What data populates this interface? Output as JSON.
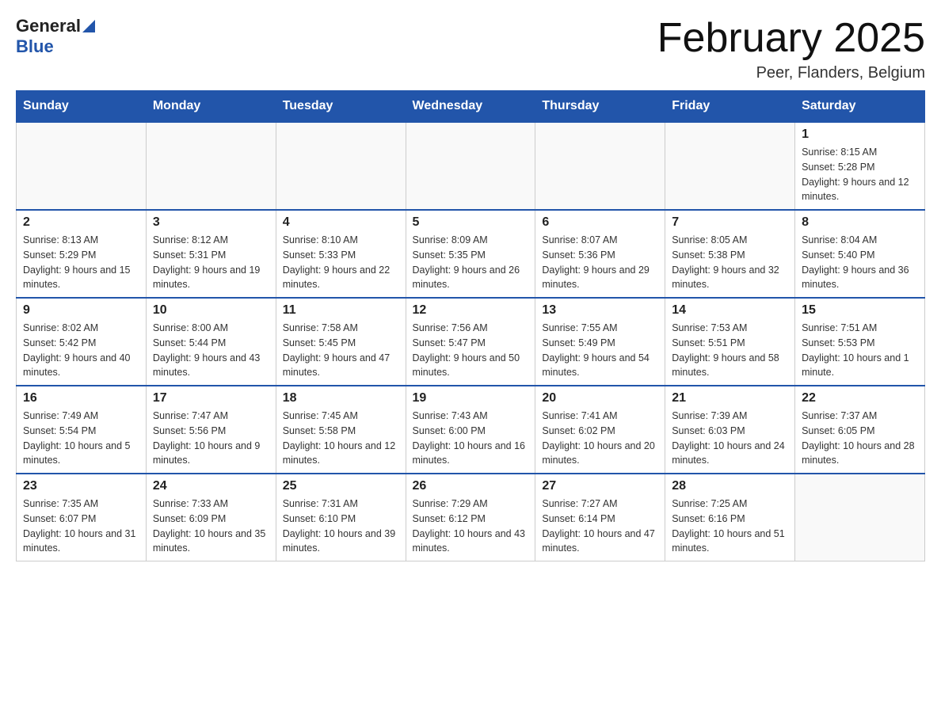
{
  "header": {
    "logo_general": "General",
    "logo_blue": "Blue",
    "month_title": "February 2025",
    "location": "Peer, Flanders, Belgium"
  },
  "days_of_week": [
    "Sunday",
    "Monday",
    "Tuesday",
    "Wednesday",
    "Thursday",
    "Friday",
    "Saturday"
  ],
  "weeks": [
    [
      {
        "day": "",
        "info": ""
      },
      {
        "day": "",
        "info": ""
      },
      {
        "day": "",
        "info": ""
      },
      {
        "day": "",
        "info": ""
      },
      {
        "day": "",
        "info": ""
      },
      {
        "day": "",
        "info": ""
      },
      {
        "day": "1",
        "info": "Sunrise: 8:15 AM\nSunset: 5:28 PM\nDaylight: 9 hours and 12 minutes."
      }
    ],
    [
      {
        "day": "2",
        "info": "Sunrise: 8:13 AM\nSunset: 5:29 PM\nDaylight: 9 hours and 15 minutes."
      },
      {
        "day": "3",
        "info": "Sunrise: 8:12 AM\nSunset: 5:31 PM\nDaylight: 9 hours and 19 minutes."
      },
      {
        "day": "4",
        "info": "Sunrise: 8:10 AM\nSunset: 5:33 PM\nDaylight: 9 hours and 22 minutes."
      },
      {
        "day": "5",
        "info": "Sunrise: 8:09 AM\nSunset: 5:35 PM\nDaylight: 9 hours and 26 minutes."
      },
      {
        "day": "6",
        "info": "Sunrise: 8:07 AM\nSunset: 5:36 PM\nDaylight: 9 hours and 29 minutes."
      },
      {
        "day": "7",
        "info": "Sunrise: 8:05 AM\nSunset: 5:38 PM\nDaylight: 9 hours and 32 minutes."
      },
      {
        "day": "8",
        "info": "Sunrise: 8:04 AM\nSunset: 5:40 PM\nDaylight: 9 hours and 36 minutes."
      }
    ],
    [
      {
        "day": "9",
        "info": "Sunrise: 8:02 AM\nSunset: 5:42 PM\nDaylight: 9 hours and 40 minutes."
      },
      {
        "day": "10",
        "info": "Sunrise: 8:00 AM\nSunset: 5:44 PM\nDaylight: 9 hours and 43 minutes."
      },
      {
        "day": "11",
        "info": "Sunrise: 7:58 AM\nSunset: 5:45 PM\nDaylight: 9 hours and 47 minutes."
      },
      {
        "day": "12",
        "info": "Sunrise: 7:56 AM\nSunset: 5:47 PM\nDaylight: 9 hours and 50 minutes."
      },
      {
        "day": "13",
        "info": "Sunrise: 7:55 AM\nSunset: 5:49 PM\nDaylight: 9 hours and 54 minutes."
      },
      {
        "day": "14",
        "info": "Sunrise: 7:53 AM\nSunset: 5:51 PM\nDaylight: 9 hours and 58 minutes."
      },
      {
        "day": "15",
        "info": "Sunrise: 7:51 AM\nSunset: 5:53 PM\nDaylight: 10 hours and 1 minute."
      }
    ],
    [
      {
        "day": "16",
        "info": "Sunrise: 7:49 AM\nSunset: 5:54 PM\nDaylight: 10 hours and 5 minutes."
      },
      {
        "day": "17",
        "info": "Sunrise: 7:47 AM\nSunset: 5:56 PM\nDaylight: 10 hours and 9 minutes."
      },
      {
        "day": "18",
        "info": "Sunrise: 7:45 AM\nSunset: 5:58 PM\nDaylight: 10 hours and 12 minutes."
      },
      {
        "day": "19",
        "info": "Sunrise: 7:43 AM\nSunset: 6:00 PM\nDaylight: 10 hours and 16 minutes."
      },
      {
        "day": "20",
        "info": "Sunrise: 7:41 AM\nSunset: 6:02 PM\nDaylight: 10 hours and 20 minutes."
      },
      {
        "day": "21",
        "info": "Sunrise: 7:39 AM\nSunset: 6:03 PM\nDaylight: 10 hours and 24 minutes."
      },
      {
        "day": "22",
        "info": "Sunrise: 7:37 AM\nSunset: 6:05 PM\nDaylight: 10 hours and 28 minutes."
      }
    ],
    [
      {
        "day": "23",
        "info": "Sunrise: 7:35 AM\nSunset: 6:07 PM\nDaylight: 10 hours and 31 minutes."
      },
      {
        "day": "24",
        "info": "Sunrise: 7:33 AM\nSunset: 6:09 PM\nDaylight: 10 hours and 35 minutes."
      },
      {
        "day": "25",
        "info": "Sunrise: 7:31 AM\nSunset: 6:10 PM\nDaylight: 10 hours and 39 minutes."
      },
      {
        "day": "26",
        "info": "Sunrise: 7:29 AM\nSunset: 6:12 PM\nDaylight: 10 hours and 43 minutes."
      },
      {
        "day": "27",
        "info": "Sunrise: 7:27 AM\nSunset: 6:14 PM\nDaylight: 10 hours and 47 minutes."
      },
      {
        "day": "28",
        "info": "Sunrise: 7:25 AM\nSunset: 6:16 PM\nDaylight: 10 hours and 51 minutes."
      },
      {
        "day": "",
        "info": ""
      }
    ]
  ]
}
